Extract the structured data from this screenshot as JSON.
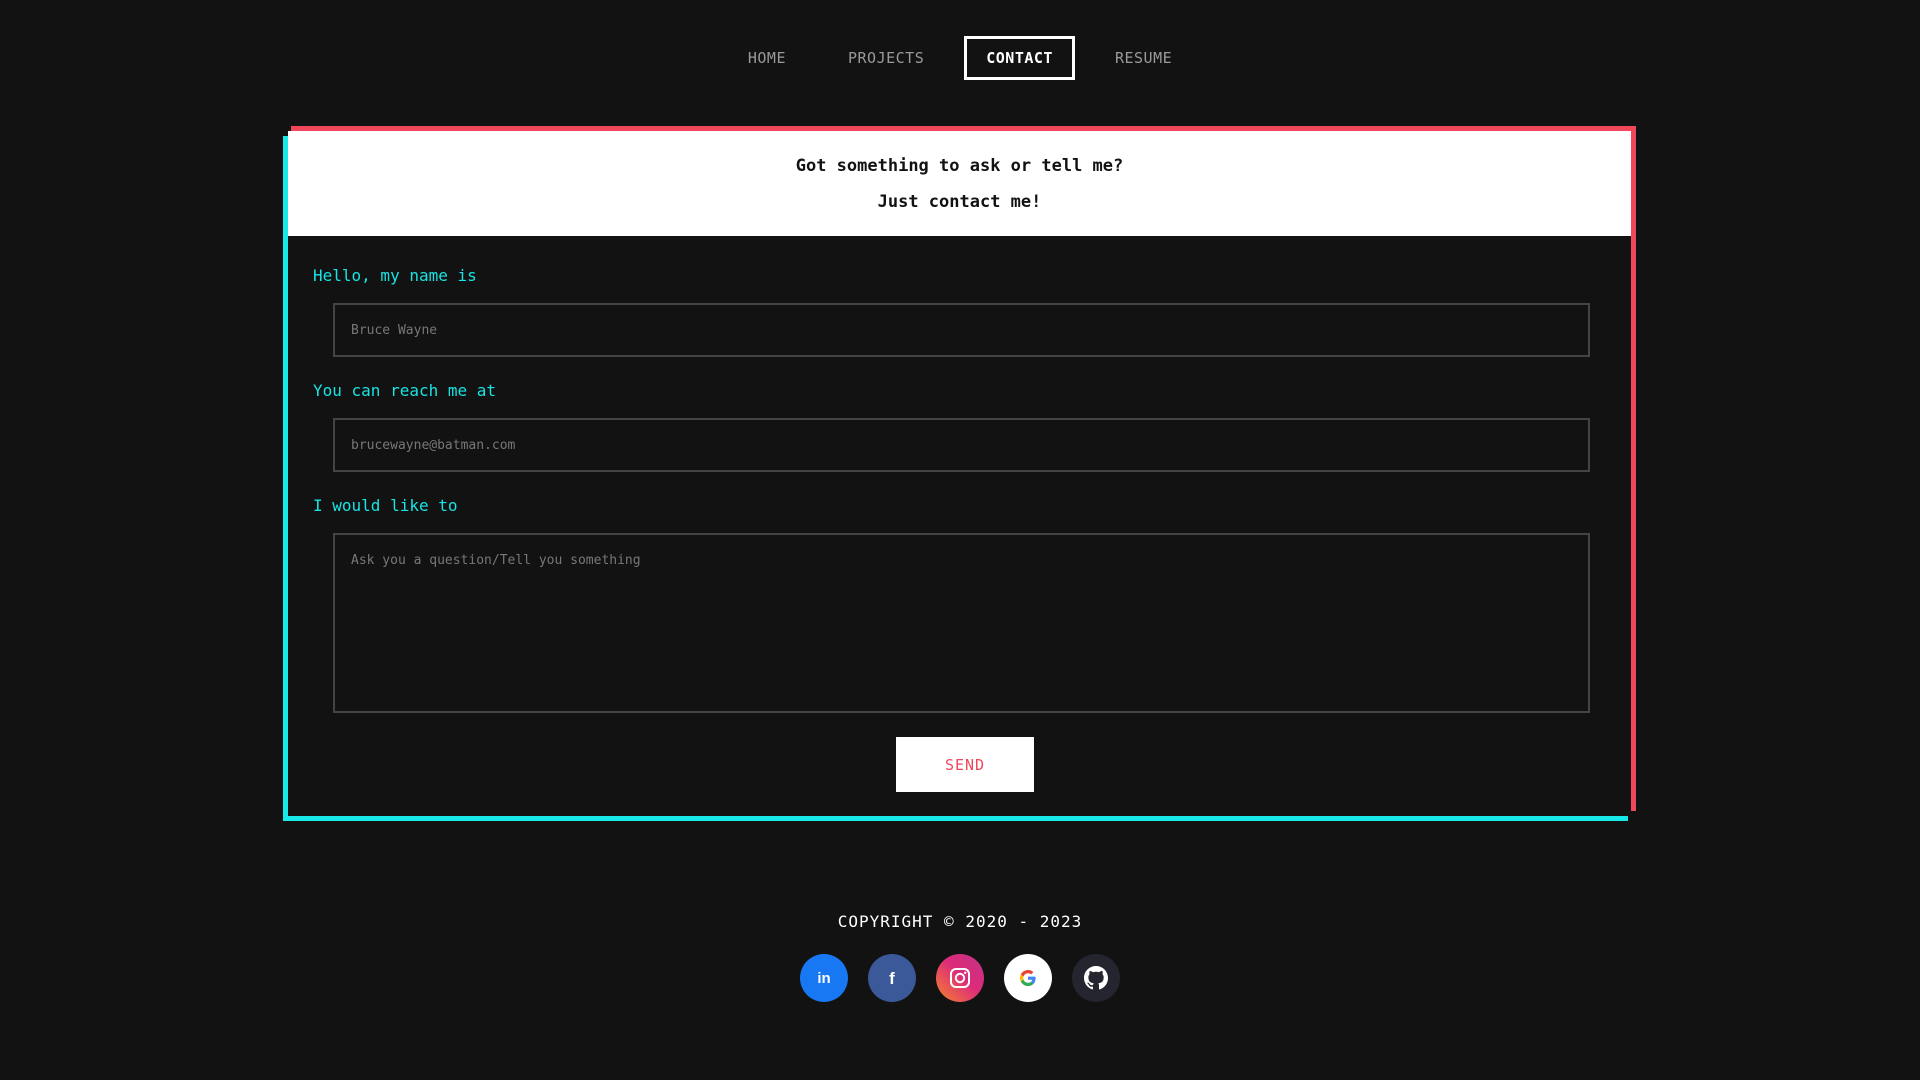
{
  "nav": {
    "items": [
      {
        "label": "HOME"
      },
      {
        "label": "PROJECTS"
      },
      {
        "label": "CONTACT"
      },
      {
        "label": "RESUME"
      }
    ],
    "active": "CONTACT"
  },
  "contact": {
    "header_line1": "Got something to ask or tell me?",
    "header_line2": "Just contact me!",
    "name_label": "Hello, my name is",
    "name_placeholder": "Bruce Wayne",
    "email_label": "You can reach me at",
    "email_placeholder": "brucewayne@batman.com",
    "message_label": "I would like to",
    "message_placeholder": "Ask you a question/Tell you something",
    "send_label": "SEND"
  },
  "footer": {
    "copyright": "COPYRIGHT © 2020 - 2023",
    "socials": [
      {
        "name": "linkedin-icon",
        "glyph": "in",
        "color": "#1877f2"
      },
      {
        "name": "facebook-icon",
        "glyph": "f",
        "color": "#3b5998"
      },
      {
        "name": "instagram-icon",
        "glyph": "",
        "color": "#e1306c"
      },
      {
        "name": "google-icon",
        "glyph": "G",
        "color": "#ffffff"
      },
      {
        "name": "github-icon",
        "glyph": "",
        "color": "#24292e"
      }
    ]
  },
  "colors": {
    "background": "#121212",
    "accent_red": "#f0485a",
    "accent_cyan": "#17e8e8",
    "label_cyan": "#19e3e3"
  }
}
